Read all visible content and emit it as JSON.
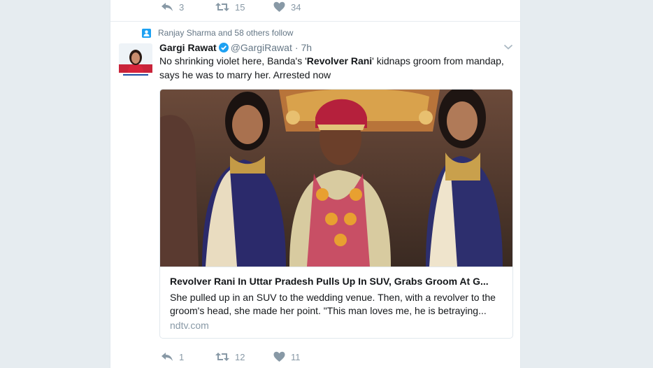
{
  "prev_tweet": {
    "reply_count": "3",
    "retweet_count": "15",
    "like_count": "34"
  },
  "tweet": {
    "social_context": "Ranjay Sharma and 58 others follow",
    "author_name": "Gargi Rawat",
    "author_handle": "@GargiRawat",
    "separator": "·",
    "timestamp": "7h",
    "text_part1": "No shrinking violet here, Banda's '",
    "text_bold": "Revolver Rani",
    "text_part2": "' kidnaps groom from mandap, says he was to marry her. Arrested now",
    "card": {
      "title": "Revolver Rani In Uttar Pradesh Pulls Up In SUV, Grabs Groom At G...",
      "description": "She pulled up in an SUV to the wedding venue. Then, with a revolver to the groom's head, she made her point. \"This man loves me, he is betraying...",
      "domain": "ndtv.com"
    },
    "reply_count": "1",
    "retweet_count": "12",
    "like_count": "11"
  },
  "colors": {
    "background": "#e6ecf0",
    "accent": "#1da1f2",
    "muted": "#8899a6",
    "text": "#14171a"
  },
  "icons": [
    "reply-icon",
    "retweet-icon",
    "heart-icon",
    "follow-context-icon",
    "verified-badge-icon",
    "caret-down-icon"
  ]
}
